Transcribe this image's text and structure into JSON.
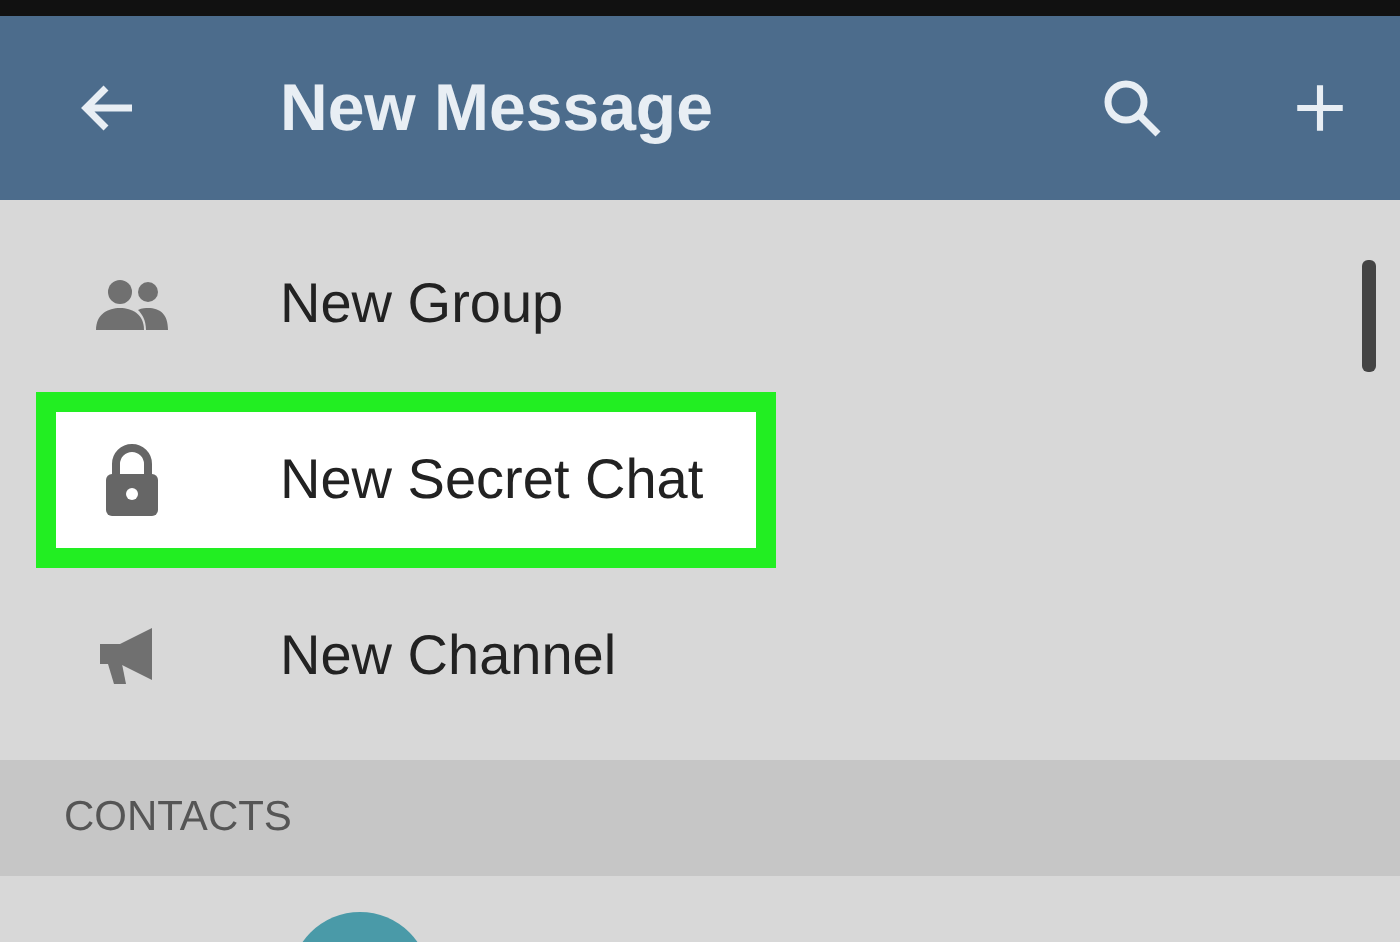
{
  "header": {
    "title": "New Message"
  },
  "menu_items": [
    {
      "kind": "group",
      "label": "New Group",
      "highlighted": false
    },
    {
      "kind": "lock",
      "label": "New Secret Chat",
      "highlighted": true
    },
    {
      "kind": "channel",
      "label": "New Channel",
      "highlighted": false
    }
  ],
  "section_header": "CONTACTS"
}
